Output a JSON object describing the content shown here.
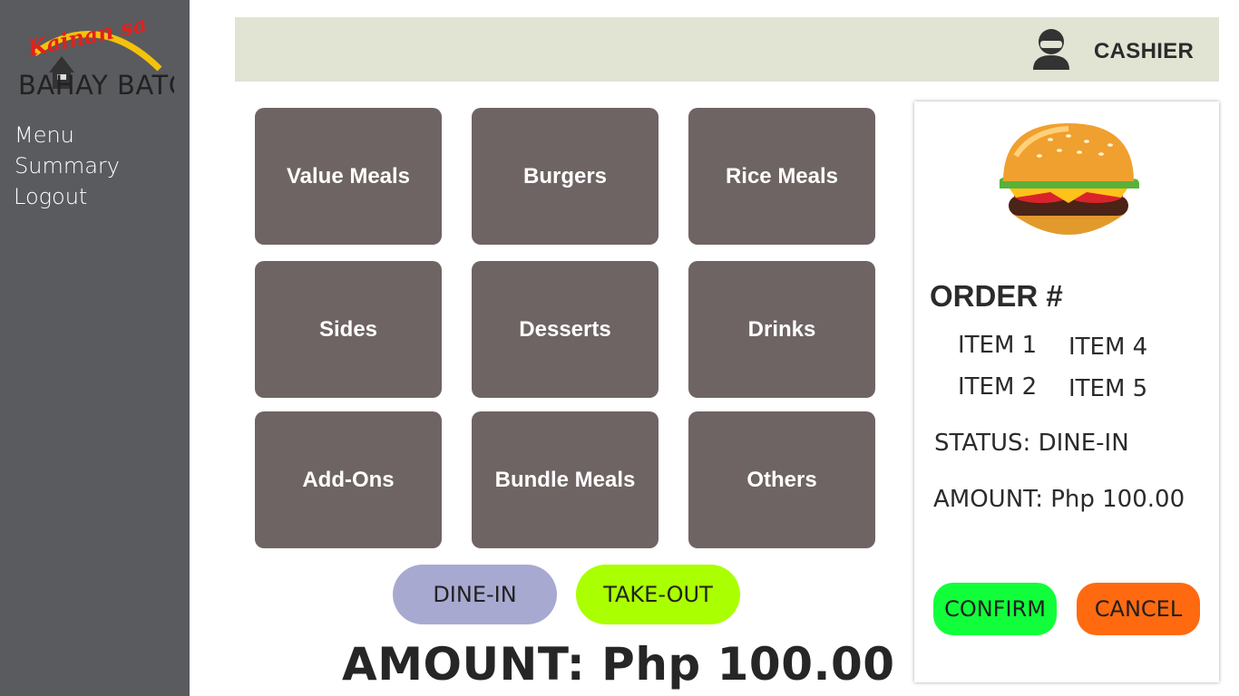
{
  "sidebar": {
    "logo_text_top": "Kainan sa",
    "logo_text_bottom": "BAHAY BATO",
    "items": [
      {
        "label": "Menu"
      },
      {
        "label": "Summary"
      },
      {
        "label": "Logout"
      }
    ]
  },
  "header": {
    "user_label": "CASHIER",
    "user_icon": "user-icon"
  },
  "categories": [
    {
      "label": "Value Meals"
    },
    {
      "label": "Burgers"
    },
    {
      "label": "Rice Meals"
    },
    {
      "label": "Sides"
    },
    {
      "label": "Desserts"
    },
    {
      "label": "Drinks"
    },
    {
      "label": "Add-Ons"
    },
    {
      "label": "Bundle Meals"
    },
    {
      "label": "Others"
    }
  ],
  "order_type": {
    "dine_in_label": "DINE-IN",
    "take_out_label": "TAKE-OUT"
  },
  "amount_label": "AMOUNT: Php 100.00",
  "order": {
    "title": "ORDER #",
    "items": [
      "ITEM 1",
      "ITEM 2",
      "ITEM 4",
      "ITEM 5"
    ],
    "status": "STATUS: DINE-IN",
    "amount": "AMOUNT: Php 100.00",
    "confirm_label": "CONFIRM",
    "cancel_label": "CANCEL",
    "image_icon": "burger-icon"
  },
  "colors": {
    "sidebar": "#5a5b5f",
    "header": "#e1e3d3",
    "tile": "#6e6463",
    "dine_in": "#a8a9d1",
    "take_out": "#aaff00",
    "confirm": "#11ff3b",
    "cancel": "#ff6a10"
  }
}
